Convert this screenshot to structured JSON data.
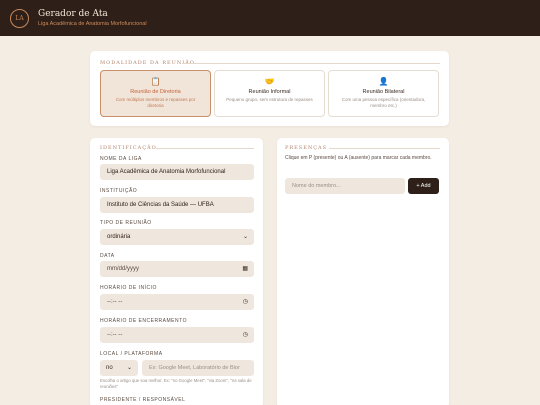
{
  "header": {
    "logo_text": "LA",
    "title": "Gerador de Ata",
    "subtitle": "Liga Acadêmica de Anatomia Morfofuncional"
  },
  "modalidade": {
    "section_title": "MODALIDADE DA REUNIÃO",
    "options": [
      {
        "label": "Reunião de Diretoria",
        "desc": "Com múltiplos membros e repasses por diretoria",
        "icon": "clipboard-icon",
        "selected": true
      },
      {
        "label": "Reunião Informal",
        "desc": "Pequeno grupo, sem estrutura de repasses",
        "icon": "handshake-icon",
        "selected": false
      },
      {
        "label": "Reunião Bilateral",
        "desc": "Com uma pessoa específica (orientadora, membro etc.)",
        "icon": "person-icon",
        "selected": false
      }
    ]
  },
  "identificacao": {
    "section_title": "IDENTIFICAÇÃO",
    "nome_label": "NOME DA LIGA",
    "nome_value": "Liga Acadêmica de Anatomia Morfofuncional",
    "instituicao_label": "INSTITUIÇÃO",
    "instituicao_value": "Instituto de Ciências da Saúde — UFBA",
    "tipo_label": "TIPO DE REUNIÃO",
    "tipo_value": "ordinária",
    "data_label": "DATA",
    "data_placeholder": "mm/dd/yyyy",
    "inicio_label": "HORÁRIO DE INÍCIO",
    "inicio_placeholder": "--:-- --",
    "fim_label": "HORÁRIO DE ENCERRAMENTO",
    "fim_placeholder": "--:-- --",
    "local_label": "LOCAL / PLATAFORMA",
    "local_prefix": "no",
    "local_placeholder": "Ex: Google Meet, Laboratório de Bior",
    "local_hint": "Escolha o artigo que soa melhor. Ex: \"no Google Meet\", \"via Zoom\", \"na sala de reuniões\"",
    "presidente_label": "PRESIDENTE / RESPONSÁVEL"
  },
  "presencas": {
    "section_title": "PRESENÇAS",
    "hint": "Clique em P (presente) ou A (ausente) para marcar cada membro.",
    "member_placeholder": "Nome do membro...",
    "add_label": "+ Add"
  }
}
